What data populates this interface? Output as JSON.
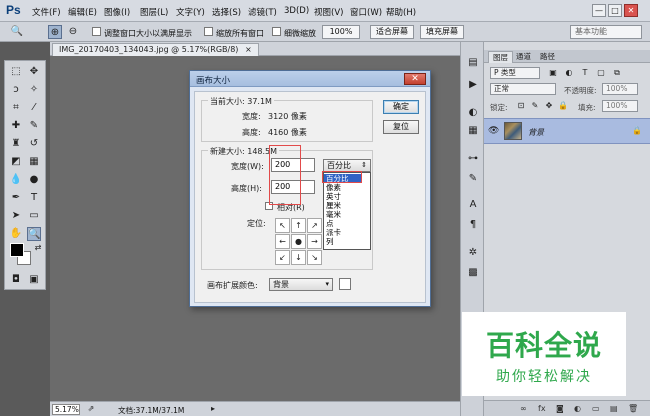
{
  "app": {
    "logo": "Ps"
  },
  "menubar": {
    "items": [
      "文件(F)",
      "编辑(E)",
      "图像(I)",
      "图层(L)",
      "文字(Y)",
      "选择(S)",
      "滤镜(T)",
      "3D(D)",
      "视图(V)",
      "窗口(W)",
      "帮助(H)"
    ],
    "window_controls": [
      "—",
      "□",
      "✕"
    ]
  },
  "options_bar": {
    "resize_window_label": "调整窗口大小以满屏显示",
    "zoom_all_label": "缩放所有窗口",
    "scrubby_label": "细微缩放",
    "zoom_100": "100%",
    "fit_screen": "适合屏幕",
    "fill_screen": "填充屏幕",
    "workspace": "基本功能"
  },
  "document": {
    "tab_title": "IMG_20170403_134043.jpg @ 5.17%(RGB/8)",
    "tab_close": "×",
    "zoom": "5.17%",
    "status": "文档:37.1M/37.1M"
  },
  "dialog": {
    "title": "画布大小",
    "current_size": {
      "title": "当前大小: 37.1M",
      "width_label": "宽度:",
      "width_value": "3120 像素",
      "height_label": "高度:",
      "height_value": "4160 像素"
    },
    "new_size": {
      "title": "新建大小: 148.5M",
      "width_label": "宽度(W):",
      "width_value": "200",
      "height_label": "高度(H):",
      "height_value": "200",
      "unit_selected": "百分比",
      "unit_options": [
        "百分比",
        "像素",
        "英寸",
        "厘米",
        "毫米",
        "点",
        "派卡",
        "列"
      ],
      "relative_label": "相对(R)",
      "anchor_label": "定位:"
    },
    "extension": {
      "label": "画布扩展颜色:",
      "value": "背景"
    },
    "ok": "确定",
    "reset": "复位",
    "close": "✕"
  },
  "panel": {
    "tabs": [
      "图层",
      "通道",
      "路径"
    ],
    "filter": "P 类型",
    "blend_mode": "正常",
    "opacity_label": "不透明度:",
    "opacity_value": "100%",
    "lock_label": "锁定:",
    "fill_label": "填充:",
    "fill_value": "100%",
    "layer_name": "背景"
  },
  "watermark": {
    "main": "百科全说",
    "sub": "助你轻松解决"
  }
}
